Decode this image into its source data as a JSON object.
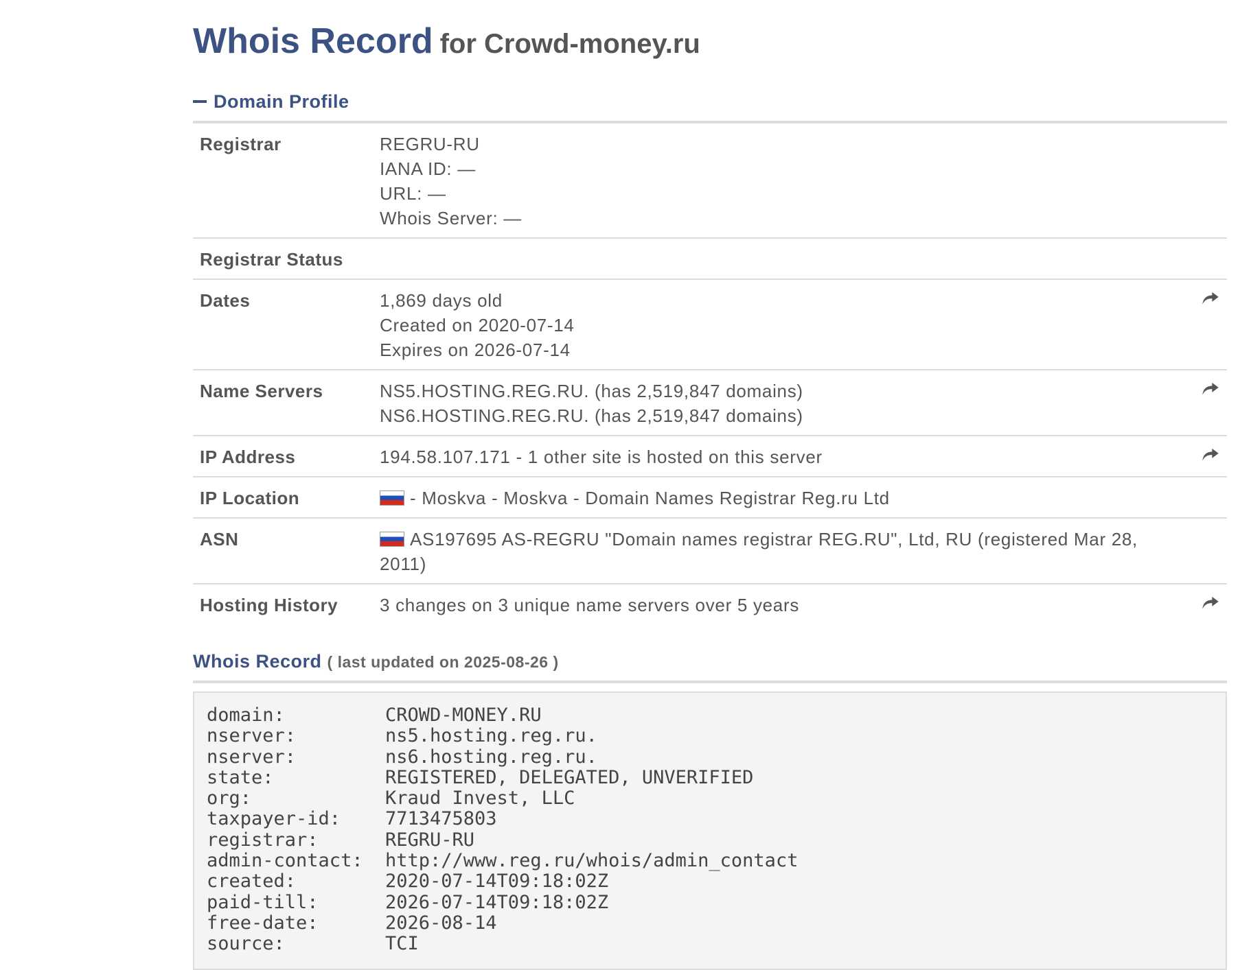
{
  "title": {
    "main": "Whois Record",
    "for": "for Crowd-money.ru"
  },
  "profile": {
    "heading": "Domain Profile"
  },
  "rows": [
    {
      "label": "Registrar",
      "lines": [
        "REGRU-RU",
        "IANA ID: —",
        "URL: —",
        "Whois Server: —"
      ]
    },
    {
      "label": "Registrar Status",
      "lines": []
    },
    {
      "label": "Dates",
      "lines": [
        "1,869 days old",
        "Created on 2020-07-14",
        "Expires on 2026-07-14"
      ]
    },
    {
      "label": "Name Servers",
      "lines": [
        "NS5.HOSTING.REG.RU. (has 2,519,847 domains)",
        "NS6.HOSTING.REG.RU. (has 2,519,847 domains)"
      ]
    },
    {
      "label": "IP Address",
      "lines": [
        "194.58.107.171 - 1 other site is hosted on this server"
      ]
    },
    {
      "label": "IP Location",
      "lines": [
        "- Moskva - Moskva - Domain Names Registrar Reg.ru Ltd"
      ]
    },
    {
      "label": "ASN",
      "lines": [
        "AS197695 AS-REGRU \"Domain names registrar REG.RU\", Ltd, RU (registered Mar 28, 2011)"
      ]
    },
    {
      "label": "Hosting History",
      "lines": [
        "3 changes on 3 unique name servers over 5 years"
      ]
    }
  ],
  "record": {
    "heading": "Whois Record",
    "updated": "( last updated on 2025-08-26 )",
    "lines": [
      {
        "key": "domain:",
        "val": "CROWD-MONEY.RU"
      },
      {
        "key": "nserver:",
        "val": "ns5.hosting.reg.ru."
      },
      {
        "key": "nserver:",
        "val": "ns6.hosting.reg.ru."
      },
      {
        "key": "state:",
        "val": "REGISTERED, DELEGATED, UNVERIFIED"
      },
      {
        "key": "org:",
        "val": "Kraud Invest, LLC"
      },
      {
        "key": "taxpayer-id:",
        "val": "7713475803"
      },
      {
        "key": "registrar:",
        "val": "REGRU-RU"
      },
      {
        "key": "admin-contact:",
        "val": "http://www.reg.ru/whois/admin_contact"
      },
      {
        "key": "created:",
        "val": "2020-07-14T09:18:02Z"
      },
      {
        "key": "paid-till:",
        "val": "2026-07-14T09:18:02Z"
      },
      {
        "key": "free-date:",
        "val": "2026-08-14"
      },
      {
        "key": "source:",
        "val": "TCI"
      }
    ]
  },
  "colors": {
    "accent": "#3b5283",
    "text": "#4a4a4a",
    "rule": "#dcdcdc",
    "code_bg": "#f4f4f4"
  },
  "icons": {
    "share": "share-arrow-icon",
    "flag": "russia-flag-icon",
    "collapse": "minus-icon"
  }
}
